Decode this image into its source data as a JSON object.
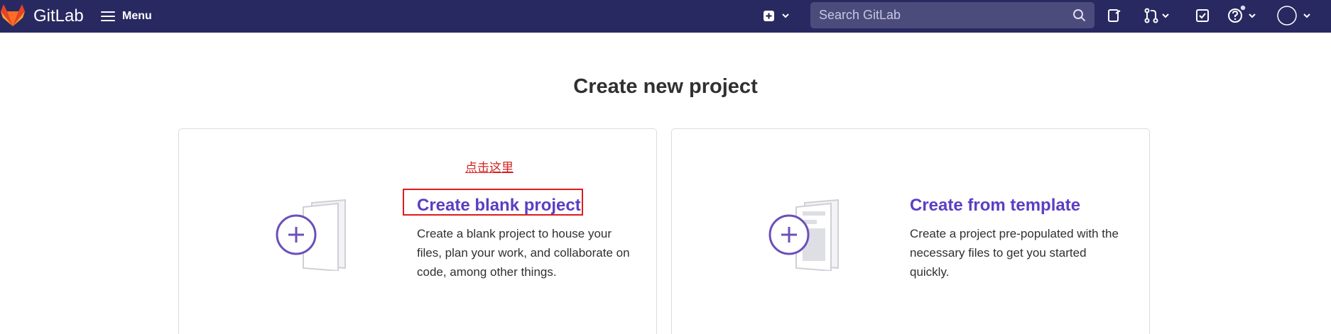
{
  "navbar": {
    "brand": "GitLab",
    "menu_label": "Menu",
    "search": {
      "placeholder": "Search GitLab",
      "value": ""
    }
  },
  "page": {
    "title": "Create new project"
  },
  "options": [
    {
      "title": "Create blank project",
      "description": "Create a blank project to house your files, plan your work, and collaborate on code, among other things."
    },
    {
      "title": "Create from template",
      "description": "Create a project pre-populated with the necessary files to get you started quickly."
    }
  ],
  "annotation": {
    "text": "点击这里",
    "color": "#e01b1b"
  },
  "colors": {
    "navbar_bg": "#292961",
    "accent": "#5b3ec3",
    "logo_orange": "#fc6d26"
  },
  "icons": [
    "gitlab-logo",
    "hamburger-icon",
    "plus-square-icon",
    "chevron-down-icon",
    "search-icon",
    "issues-icon",
    "merge-request-icon",
    "todo-icon",
    "help-icon",
    "avatar"
  ]
}
